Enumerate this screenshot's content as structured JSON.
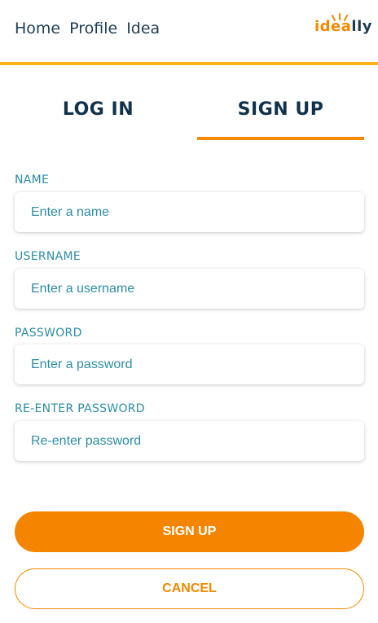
{
  "nav": {
    "links": [
      "Home",
      "Profile",
      "Idea"
    ],
    "logo_text_part1": "idea",
    "logo_text_part2": "lly"
  },
  "tabs": {
    "login": "LOG IN",
    "signup": "SIGN UP",
    "active": "signup"
  },
  "form": {
    "fields": [
      {
        "label": "NAME",
        "placeholder": "Enter a name",
        "value": ""
      },
      {
        "label": "USERNAME",
        "placeholder": "Enter a username",
        "value": ""
      },
      {
        "label": "PASSWORD",
        "placeholder": "Enter a password",
        "value": ""
      },
      {
        "label": "RE-ENTER PASSWORD",
        "placeholder": "Re-enter password",
        "value": ""
      }
    ]
  },
  "buttons": {
    "signup": "SIGN UP",
    "cancel": "CANCEL"
  },
  "colors": {
    "accent_orange": "#f58500",
    "nav_border_yellow": "#f6b31a",
    "label_teal": "#2e8ca6",
    "text_navy": "#10324a"
  }
}
